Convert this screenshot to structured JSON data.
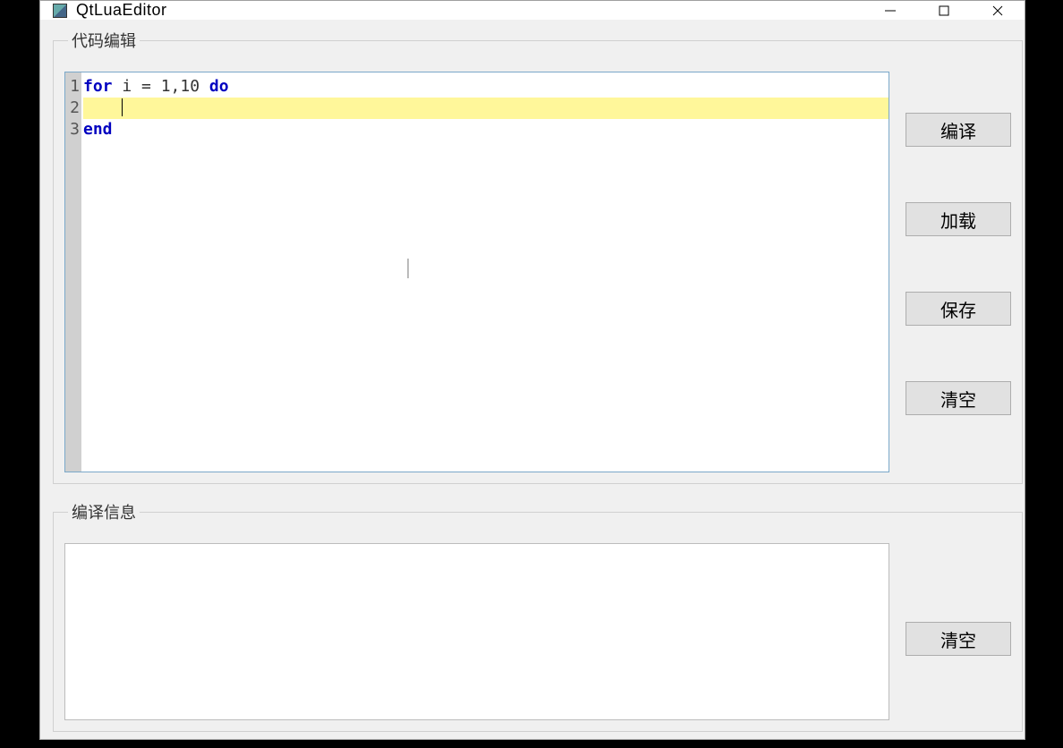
{
  "window": {
    "title": "QtLuaEditor"
  },
  "groups": {
    "editor_title": "代码编辑",
    "compile_title": "编译信息"
  },
  "buttons": {
    "compile": "编译",
    "load": "加载",
    "save": "保存",
    "clear_editor": "清空",
    "clear_output": "清空"
  },
  "editor": {
    "lines": [
      {
        "num": "1",
        "text": "for i = 1,10 do",
        "current": false
      },
      {
        "num": "2",
        "text": "    ",
        "current": true
      },
      {
        "num": "3",
        "text": "end",
        "current": false
      }
    ],
    "cursor_line": 2,
    "cursor_col": 5
  },
  "compile_output": ""
}
